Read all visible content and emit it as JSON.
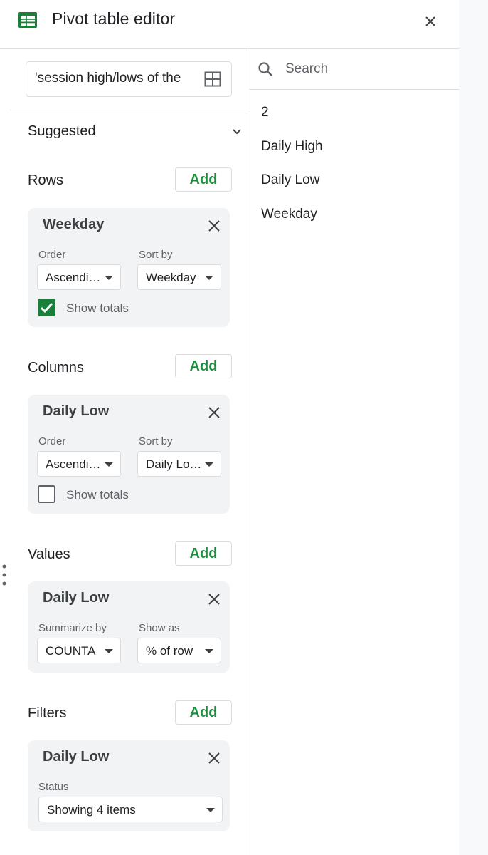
{
  "header": {
    "title": "Pivot table editor",
    "app_icon": "sheets-icon",
    "close_icon": "close-icon"
  },
  "range": {
    "value": "'session high/lows of the",
    "grid_icon": "grid-icon"
  },
  "suggested": {
    "label": "Suggested"
  },
  "rows": {
    "label": "Rows",
    "add_label": "Add",
    "card": {
      "title": "Weekday",
      "order_label": "Order",
      "order_value": "Ascendi…",
      "sort_label": "Sort by",
      "sort_value": "Weekday",
      "show_totals_label": "Show totals",
      "show_totals_checked": true
    }
  },
  "columns": {
    "label": "Columns",
    "add_label": "Add",
    "card": {
      "title": "Daily Low",
      "order_label": "Order",
      "order_value": "Ascendi…",
      "sort_label": "Sort by",
      "sort_value": "Daily Lo…",
      "show_totals_label": "Show totals",
      "show_totals_checked": false
    }
  },
  "values": {
    "label": "Values",
    "add_label": "Add",
    "card": {
      "title": "Daily Low",
      "summarize_label": "Summarize by",
      "summarize_value": "COUNTA",
      "show_as_label": "Show as",
      "show_as_value": "% of row"
    }
  },
  "filters": {
    "label": "Filters",
    "add_label": "Add",
    "card": {
      "title": "Daily Low",
      "status_label": "Status",
      "status_value": "Showing 4 items"
    }
  },
  "field_search": {
    "placeholder": "Search"
  },
  "field_list": [
    {
      "label": "2"
    },
    {
      "label": "Daily High"
    },
    {
      "label": "Daily Low"
    },
    {
      "label": "Weekday"
    }
  ],
  "colors": {
    "accent_green": "#1e8e3e",
    "checkbox_green": "#188038",
    "card_bg": "#f1f3f4",
    "border": "#dadce0"
  }
}
